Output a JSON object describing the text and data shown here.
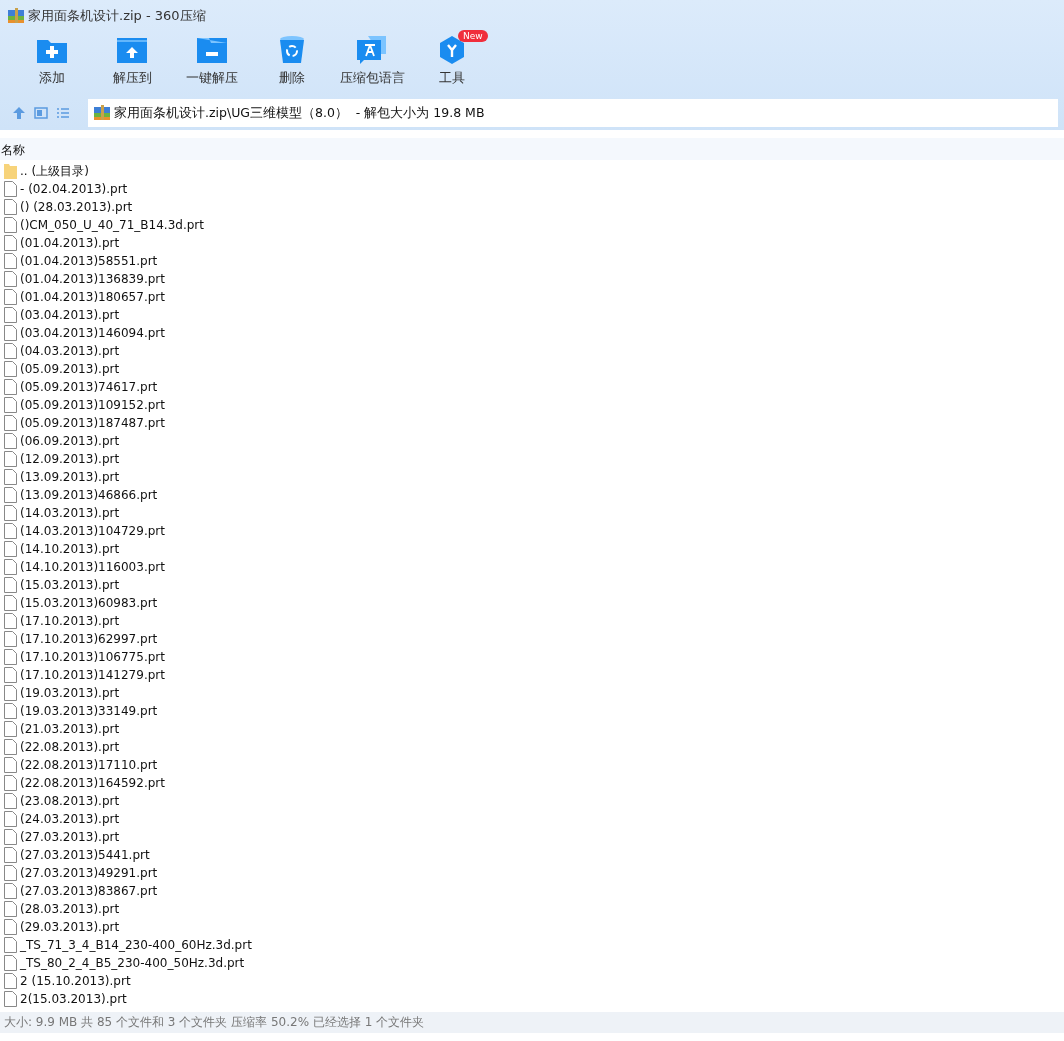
{
  "window": {
    "title": "家用面条机设计.zip - 360压缩"
  },
  "toolbar": [
    {
      "label": "添加",
      "kind": "add"
    },
    {
      "label": "解压到",
      "kind": "extract"
    },
    {
      "label": "一键解压",
      "kind": "oneclick"
    },
    {
      "label": "删除",
      "kind": "delete"
    },
    {
      "label": "压缩包语言",
      "kind": "language"
    },
    {
      "label": "工具",
      "kind": "tools",
      "badge": "New"
    }
  ],
  "address_bar": {
    "path": "家用面条机设计.zip\\UG三维模型（8.0）",
    "info": " - 解包大小为 19.8 MB"
  },
  "list": {
    "column": "名称",
    "items": [
      {
        "name": ".. (上级目录)",
        "kind": "folder"
      },
      {
        "name": "- (02.04.2013).prt",
        "kind": "file"
      },
      {
        "name": "() (28.03.2013).prt",
        "kind": "file"
      },
      {
        "name": "()CM_050_U_40_71_B14.3d.prt",
        "kind": "file"
      },
      {
        "name": "(01.04.2013).prt",
        "kind": "file"
      },
      {
        "name": "(01.04.2013)58551.prt",
        "kind": "file"
      },
      {
        "name": "(01.04.2013)136839.prt",
        "kind": "file"
      },
      {
        "name": "(01.04.2013)180657.prt",
        "kind": "file"
      },
      {
        "name": "(03.04.2013).prt",
        "kind": "file"
      },
      {
        "name": "(03.04.2013)146094.prt",
        "kind": "file"
      },
      {
        "name": "(04.03.2013).prt",
        "kind": "file"
      },
      {
        "name": "(05.09.2013).prt",
        "kind": "file"
      },
      {
        "name": "(05.09.2013)74617.prt",
        "kind": "file"
      },
      {
        "name": "(05.09.2013)109152.prt",
        "kind": "file"
      },
      {
        "name": "(05.09.2013)187487.prt",
        "kind": "file"
      },
      {
        "name": "(06.09.2013).prt",
        "kind": "file"
      },
      {
        "name": "(12.09.2013).prt",
        "kind": "file"
      },
      {
        "name": "(13.09.2013).prt",
        "kind": "file"
      },
      {
        "name": "(13.09.2013)46866.prt",
        "kind": "file"
      },
      {
        "name": "(14.03.2013).prt",
        "kind": "file"
      },
      {
        "name": "(14.03.2013)104729.prt",
        "kind": "file"
      },
      {
        "name": "(14.10.2013).prt",
        "kind": "file"
      },
      {
        "name": "(14.10.2013)116003.prt",
        "kind": "file"
      },
      {
        "name": "(15.03.2013).prt",
        "kind": "file"
      },
      {
        "name": "(15.03.2013)60983.prt",
        "kind": "file"
      },
      {
        "name": "(17.10.2013).prt",
        "kind": "file"
      },
      {
        "name": "(17.10.2013)62997.prt",
        "kind": "file"
      },
      {
        "name": "(17.10.2013)106775.prt",
        "kind": "file"
      },
      {
        "name": "(17.10.2013)141279.prt",
        "kind": "file"
      },
      {
        "name": "(19.03.2013).prt",
        "kind": "file"
      },
      {
        "name": "(19.03.2013)33149.prt",
        "kind": "file"
      },
      {
        "name": "(21.03.2013).prt",
        "kind": "file"
      },
      {
        "name": "(22.08.2013).prt",
        "kind": "file"
      },
      {
        "name": "(22.08.2013)17110.prt",
        "kind": "file"
      },
      {
        "name": "(22.08.2013)164592.prt",
        "kind": "file"
      },
      {
        "name": "(23.08.2013).prt",
        "kind": "file"
      },
      {
        "name": "(24.03.2013).prt",
        "kind": "file"
      },
      {
        "name": "(27.03.2013).prt",
        "kind": "file"
      },
      {
        "name": "(27.03.2013)5441.prt",
        "kind": "file"
      },
      {
        "name": "(27.03.2013)49291.prt",
        "kind": "file"
      },
      {
        "name": "(27.03.2013)83867.prt",
        "kind": "file"
      },
      {
        "name": "(28.03.2013).prt",
        "kind": "file"
      },
      {
        "name": "(29.03.2013).prt",
        "kind": "file"
      },
      {
        "name": "_TS_71_3_4_B14_230-400_60Hz.3d.prt",
        "kind": "file"
      },
      {
        "name": "_TS_80_2_4_B5_230-400_50Hz.3d.prt",
        "kind": "file"
      },
      {
        "name": "2 (15.10.2013).prt",
        "kind": "file"
      },
      {
        "name": "2(15.03.2013).prt",
        "kind": "file"
      }
    ]
  },
  "status_bar": "大小: 9.9 MB 共 85 个文件和 3 个文件夹 压缩率 50.2% 已经选择 1 个文件夹"
}
